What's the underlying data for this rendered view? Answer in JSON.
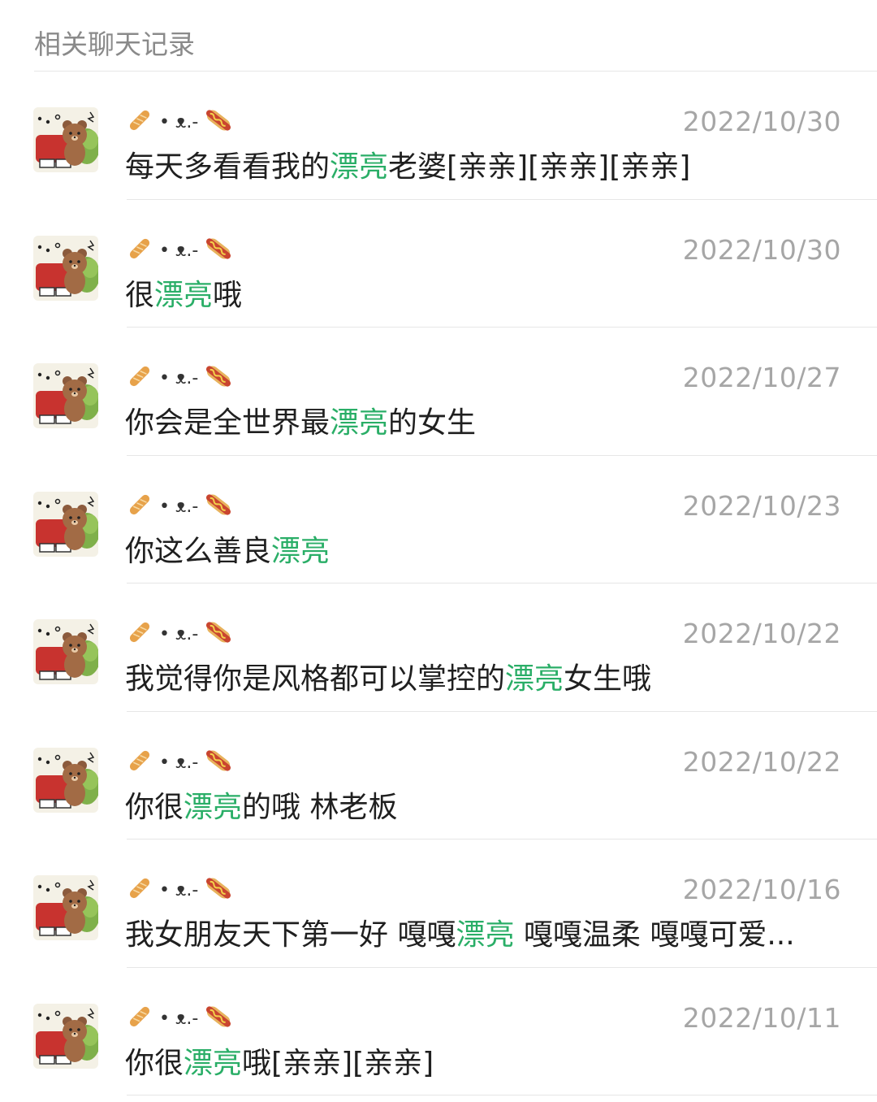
{
  "header": {
    "title": "相关聊天记录"
  },
  "sender": {
    "name_middle": "• ᴥ.-"
  },
  "colors": {
    "highlight": "#2aae67",
    "date": "#a6a6a6",
    "divider": "#e6e6e6"
  },
  "results": [
    {
      "date": "2022/10/30",
      "before": "每天多看看我的",
      "match": "漂亮",
      "after": "老婆[亲亲][亲亲][亲亲]"
    },
    {
      "date": "2022/10/30",
      "before": "很",
      "match": "漂亮",
      "after": "哦"
    },
    {
      "date": "2022/10/27",
      "before": "你会是全世界最",
      "match": "漂亮",
      "after": "的女生"
    },
    {
      "date": "2022/10/23",
      "before": "你这么善良",
      "match": "漂亮",
      "after": ""
    },
    {
      "date": "2022/10/22",
      "before": "我觉得你是风格都可以掌控的",
      "match": "漂亮",
      "after": "女生哦"
    },
    {
      "date": "2022/10/22",
      "before": "你很",
      "match": "漂亮",
      "after": "的哦 林老板"
    },
    {
      "date": "2022/10/16",
      "before": "我女朋友天下第一好 嘎嘎",
      "match": "漂亮",
      "after": " 嘎嘎温柔  嘎嘎可爱..."
    },
    {
      "date": "2022/10/11",
      "before": "你很",
      "match": "漂亮",
      "after": "哦[亲亲][亲亲]"
    }
  ]
}
